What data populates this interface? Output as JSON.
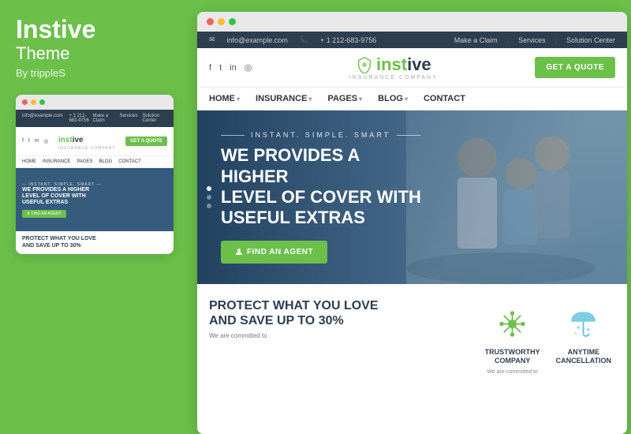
{
  "left": {
    "brand": {
      "title": "Instive",
      "subtitle": "Theme",
      "by": "By trippleS"
    }
  },
  "mini": {
    "topbar": {
      "email": "info@example.com",
      "phone": "+ 1 212-683-9756",
      "links": [
        "Make a Claim",
        "Services",
        "Solution Center"
      ]
    },
    "header": {
      "logo": "instive",
      "logo_sub": "INSURANCE COMPANY",
      "get_quote": "GET A QUOTE"
    },
    "nav": [
      "HOME",
      "INSURANCE",
      "PAGES",
      "BLOG",
      "CONTACT"
    ],
    "hero": {
      "tagline": "INSTANT. SIMPLE. SMART",
      "title": "WE PROVIDES A HIGHER LEVEL OF COVER WITH USEFUL EXTRAS",
      "btn": "FIND AN AGENT"
    },
    "bottom": {
      "title": "PROTECT WHAT YOU LOVE AND SAVE UP TO 30%"
    }
  },
  "main": {
    "topbar": {
      "email": "info@example.com",
      "phone": "+ 1 212-683-9756",
      "links": [
        "Make a Claim",
        "Services",
        "Solution Center"
      ]
    },
    "header": {
      "social": [
        "f",
        "t",
        "in",
        "📷"
      ],
      "logo_text": "instive",
      "logo_sub": "INSURANCE COMPANY",
      "get_quote": "GET A QUOTE"
    },
    "nav": {
      "items": [
        "HOME",
        "INSURANCE",
        "PAGES",
        "BLOG",
        "CONTACT"
      ],
      "has_dropdown": [
        true,
        true,
        true,
        true,
        false
      ]
    },
    "hero": {
      "tagline": "INSTANT. SIMPLE. SMART",
      "title_line1": "WE PROVIDES A HIGHER",
      "title_line2": "LEVEL OF COVER WITH",
      "title_line3": "USEFUL EXTRAS",
      "btn": "FIND AN AGENT"
    },
    "bottom": {
      "left": {
        "title_line1": "PROTECT WHAT YOU LOVE",
        "title_line2": "AND SAVE UP TO 30%",
        "desc": "We are committed to"
      },
      "features": [
        {
          "name": "trustworthy",
          "title": "TRUSTWORTHY\nCOMPANY",
          "desc": "We are committed to",
          "icon_color": "#6cc04a"
        },
        {
          "name": "anytime",
          "title": "ANYTIME\nCANCELLATION",
          "desc": "",
          "icon_color": "#5bc0de"
        }
      ]
    }
  },
  "colors": {
    "green": "#6cc04a",
    "dark": "#2c3e50",
    "topbar_bg": "#2c3e50",
    "blue": "#5bc0de"
  }
}
